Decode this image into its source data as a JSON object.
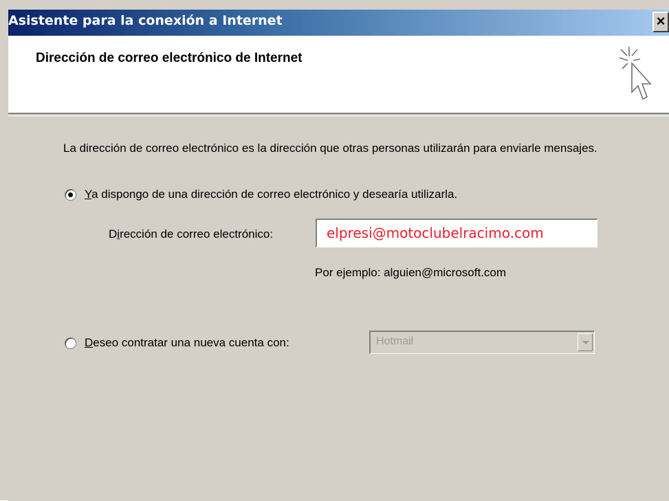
{
  "window": {
    "title": "Asistente para la conexión a Internet",
    "close_glyph": "×"
  },
  "header": {
    "title": "Dirección de correo electrónico de Internet",
    "icon": "wizard-cursor-icon"
  },
  "intro_text": "La dirección de correo electrónico es la dirección que otras personas utilizarán para enviarle mensajes.",
  "option_existing": {
    "mnemonic": "Y",
    "label_rest": "a dispongo de una dirección de correo electrónico y desearía utilizarla.",
    "checked": true
  },
  "email": {
    "label_prefix": "D",
    "label_mnemonic": "i",
    "label_rest": "rección de correo electrónico:",
    "value": "elpresi@motoclubelracimo.com",
    "value_color": "#e8202e"
  },
  "example_text": "Por ejemplo: alguien@microsoft.com",
  "option_new": {
    "mnemonic": "D",
    "label_rest": "eseo contratar una nueva cuenta con:",
    "checked": false
  },
  "provider_select": {
    "value": "Hotmail",
    "enabled": false
  }
}
